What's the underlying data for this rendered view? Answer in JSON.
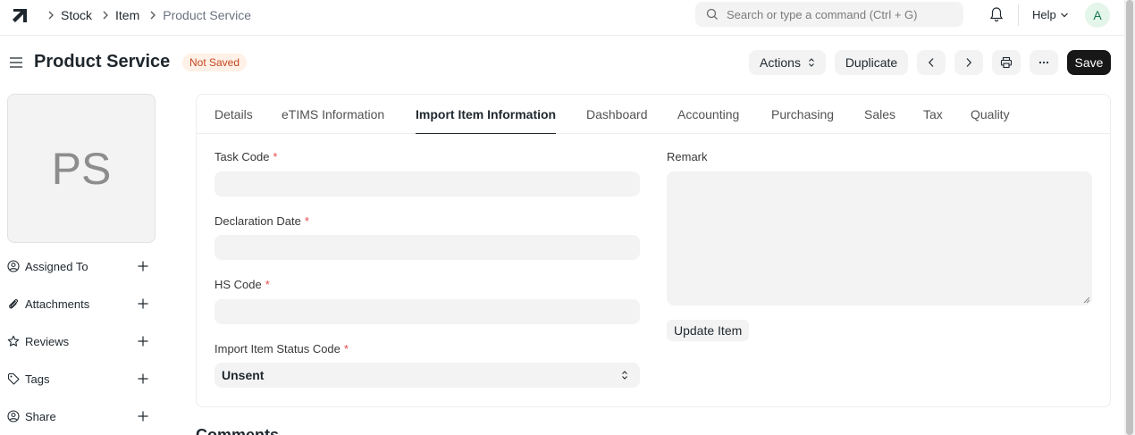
{
  "navbar": {
    "breadcrumbs": [
      "Stock",
      "Item",
      "Product Service"
    ],
    "search_placeholder": "Search or type a command (Ctrl + G)",
    "help_label": "Help",
    "avatar_initial": "A"
  },
  "page": {
    "title": "Product Service",
    "status": "Not Saved",
    "actions_label": "Actions",
    "duplicate_label": "Duplicate",
    "save_label": "Save"
  },
  "sidebar": {
    "image_initials": "PS",
    "items": [
      "Assigned To",
      "Attachments",
      "Reviews",
      "Tags",
      "Share"
    ]
  },
  "tabs": [
    "Details",
    "eTIMS Information",
    "Import Item Information",
    "Dashboard",
    "Accounting",
    "Purchasing",
    "Sales",
    "Tax",
    "Quality"
  ],
  "active_tab": "Import Item Information",
  "form": {
    "task_code_label": "Task Code",
    "declaration_date_label": "Declaration Date",
    "hs_code_label": "HS Code",
    "import_status_label": "Import Item Status Code",
    "import_status_value": "Unsent",
    "required_mark": "*",
    "remark_label": "Remark",
    "update_button": "Update Item"
  },
  "comments_heading": "Comments",
  "colors": {
    "primary_button": "#171717",
    "status_badge_bg": "#fff1e7",
    "status_badge_text": "#c4461f",
    "required": "#e24c4c"
  }
}
